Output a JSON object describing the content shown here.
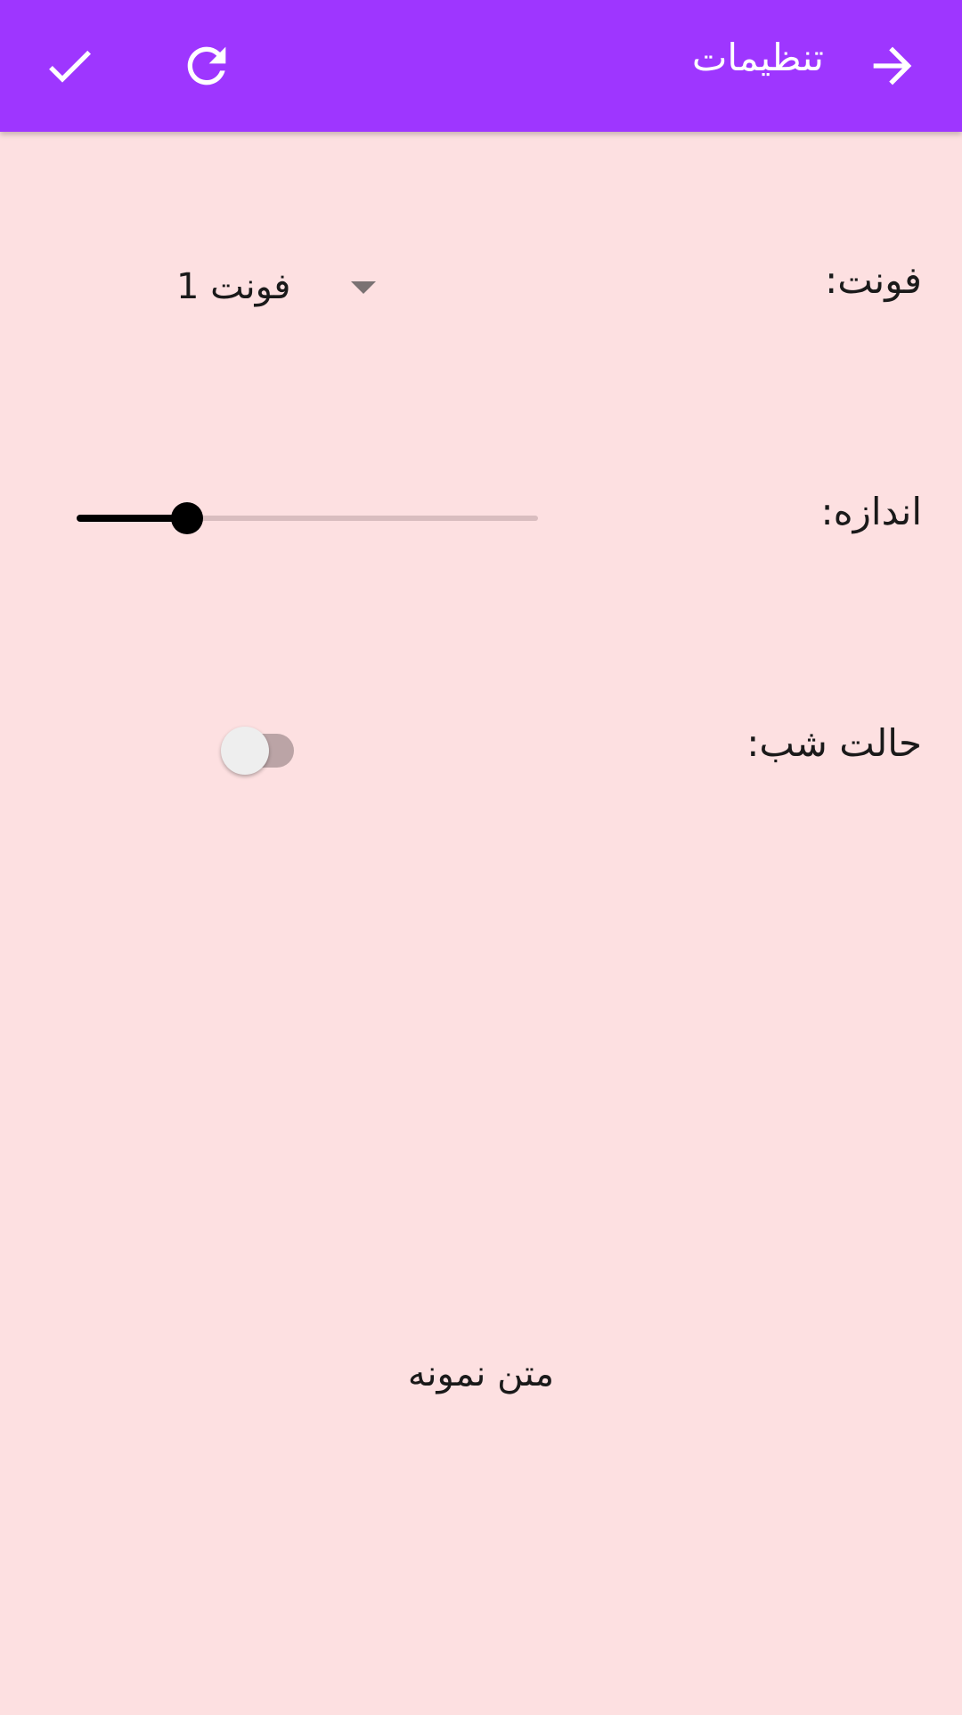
{
  "toolbar": {
    "title": "تنظیمات",
    "icons": {
      "confirm": "check-icon",
      "reset": "refresh-icon",
      "back": "arrow-forward-icon"
    },
    "background_color": "#9E36FF",
    "icon_color": "#FFFFFF"
  },
  "settings": {
    "font": {
      "label": "فونت:",
      "selected": "فونت 1"
    },
    "size": {
      "label": "اندازه:",
      "value_fraction": 0.24
    },
    "night_mode": {
      "label": "حالت شب:",
      "enabled": false
    }
  },
  "preview": {
    "text": "متن نمونه"
  },
  "colors": {
    "background": "#FDE0E1",
    "slider_active": "#000000",
    "slider_inactive": "#D9BDBF",
    "switch_track_off": "#BBA4A6",
    "switch_thumb_off": "#EEEEEE"
  }
}
